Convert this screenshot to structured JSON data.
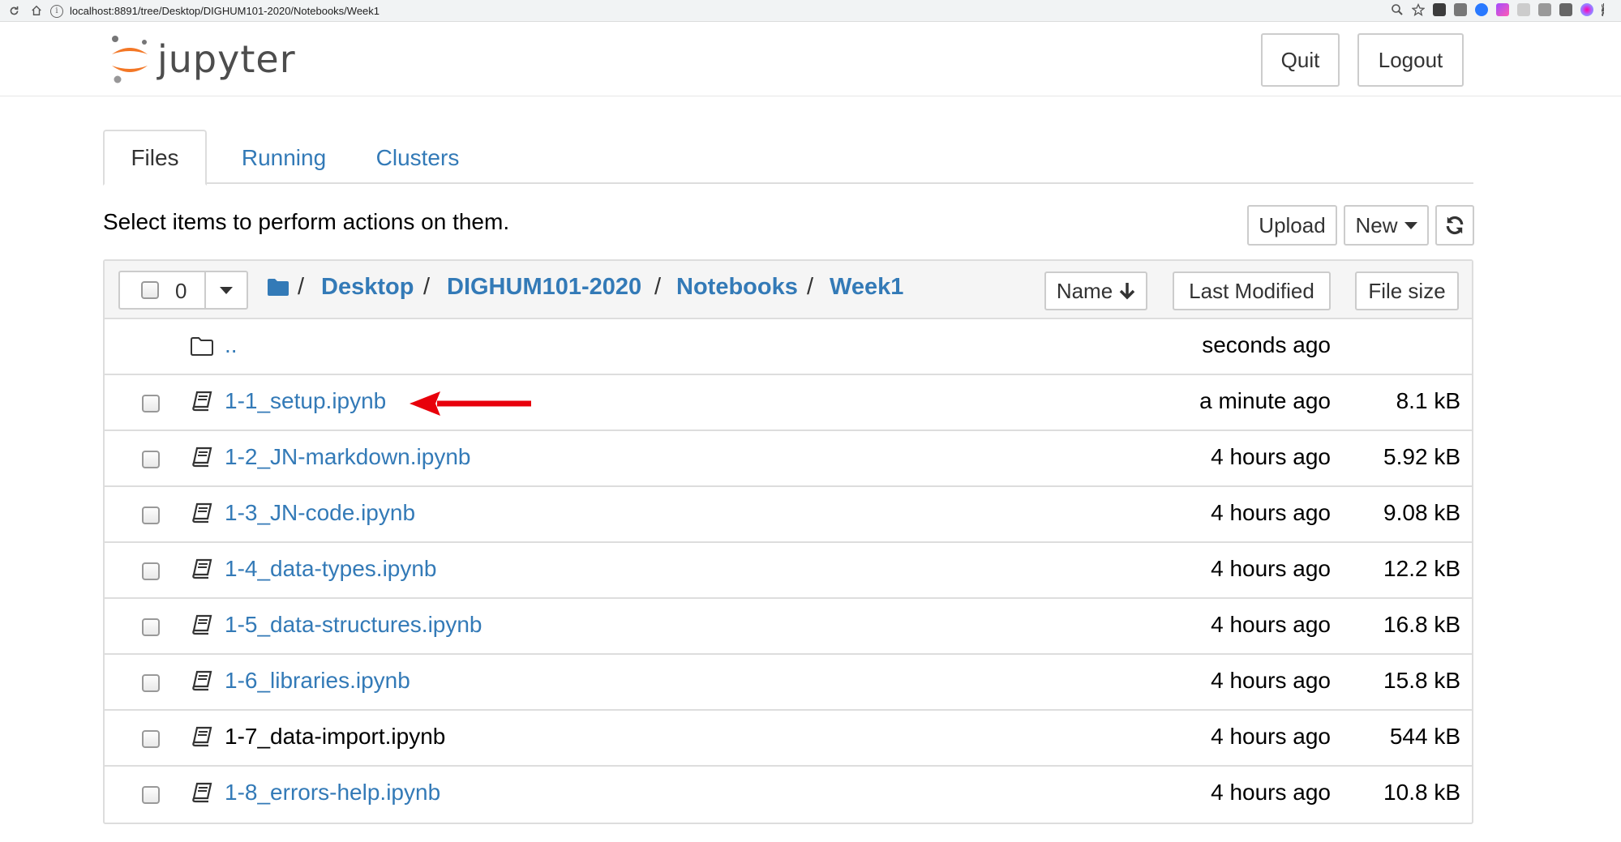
{
  "browser": {
    "url": "localhost:8891/tree/Desktop/DIGHUM101-2020/Notebooks/Week1"
  },
  "header": {
    "logo_text": "jupyter",
    "quit_label": "Quit",
    "logout_label": "Logout"
  },
  "tabs": [
    {
      "label": "Files",
      "active": true
    },
    {
      "label": "Running",
      "active": false
    },
    {
      "label": "Clusters",
      "active": false
    }
  ],
  "instructions": "Select items to perform actions on them.",
  "toolbar": {
    "upload_label": "Upload",
    "new_label": "New"
  },
  "list_header": {
    "selected_count": "0",
    "breadcrumb": [
      "Desktop",
      "DIGHUM101-2020",
      "Notebooks",
      "Week1"
    ],
    "sort_name_label": "Name",
    "sort_modified_label": "Last Modified",
    "sort_size_label": "File size"
  },
  "parent_dir": {
    "name": "..",
    "modified": "seconds ago"
  },
  "files": [
    {
      "name": "1-1_setup.ipynb",
      "modified": "a minute ago",
      "size": "8.1 kB"
    },
    {
      "name": "1-2_JN-markdown.ipynb",
      "modified": "4 hours ago",
      "size": "5.92 kB"
    },
    {
      "name": "1-3_JN-code.ipynb",
      "modified": "4 hours ago",
      "size": "9.08 kB"
    },
    {
      "name": "1-4_data-types.ipynb",
      "modified": "4 hours ago",
      "size": "12.2 kB"
    },
    {
      "name": "1-5_data-structures.ipynb",
      "modified": "4 hours ago",
      "size": "16.8 kB"
    },
    {
      "name": "1-6_libraries.ipynb",
      "modified": "4 hours ago",
      "size": "15.8 kB"
    },
    {
      "name": "1-7_data-import.ipynb",
      "modified": "4 hours ago",
      "size": "544 kB"
    },
    {
      "name": "1-8_errors-help.ipynb",
      "modified": "4 hours ago",
      "size": "10.8 kB"
    }
  ],
  "colors": {
    "link": "#337ab7",
    "jupyter_orange": "#f37726",
    "annotation_arrow": "#e8000b"
  }
}
